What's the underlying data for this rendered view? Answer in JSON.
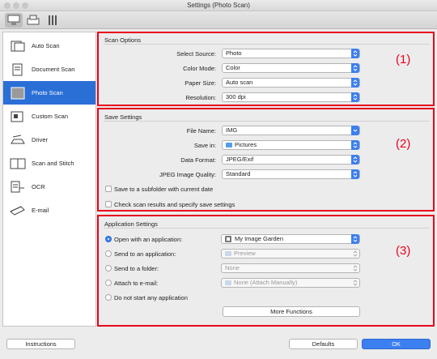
{
  "window": {
    "title": "Settings (Photo Scan)"
  },
  "sidebar": {
    "items": [
      {
        "label": "Auto Scan",
        "icon": "auto-scan-icon",
        "selected": false
      },
      {
        "label": "Document Scan",
        "icon": "document-scan-icon",
        "selected": false
      },
      {
        "label": "Photo Scan",
        "icon": "photo-scan-icon",
        "selected": true
      },
      {
        "label": "Custom Scan",
        "icon": "custom-scan-icon",
        "selected": false
      },
      {
        "label": "Driver",
        "icon": "driver-icon",
        "selected": false
      },
      {
        "label": "Scan and Stitch",
        "icon": "scan-and-stitch-icon",
        "selected": false
      },
      {
        "label": "OCR",
        "icon": "ocr-icon",
        "selected": false
      },
      {
        "label": "E-mail",
        "icon": "email-icon",
        "selected": false
      }
    ]
  },
  "scan_options": {
    "title": "Scan Options",
    "number": "(1)",
    "source_label": "Select Source:",
    "source_value": "Photo",
    "color_label": "Color Mode:",
    "color_value": "Color",
    "paper_label": "Paper Size:",
    "paper_value": "Auto scan",
    "resolution_label": "Resolution:",
    "resolution_value": "300 dpi"
  },
  "save_settings": {
    "title": "Save Settings",
    "number": "(2)",
    "filename_label": "File Name:",
    "filename_value": "IMG",
    "savein_label": "Save in:",
    "savein_value": "Pictures",
    "format_label": "Data Format:",
    "format_value": "JPEG/Exif",
    "quality_label": "JPEG Image Quality:",
    "quality_value": "Standard",
    "subfolder_label": "Save to a subfolder with current date",
    "check_label": "Check scan results and specify save settings"
  },
  "app_settings": {
    "title": "Application Settings",
    "number": "(3)",
    "open_label": "Open with an application:",
    "open_value": "My Image Garden",
    "send_app_label": "Send to an application:",
    "send_app_value": "Preview",
    "send_folder_label": "Send to a folder:",
    "send_folder_value": "None",
    "attach_label": "Attach to e-mail:",
    "attach_value": "None (Attach Manually)",
    "none_label": "Do not start any application",
    "more_label": "More Functions"
  },
  "footer": {
    "instructions": "Instructions",
    "defaults": "Defaults",
    "ok": "OK"
  },
  "colors": {
    "accent": "#3b7ff0",
    "selection": "#2a6fd6",
    "annotation": "#e8001c"
  }
}
